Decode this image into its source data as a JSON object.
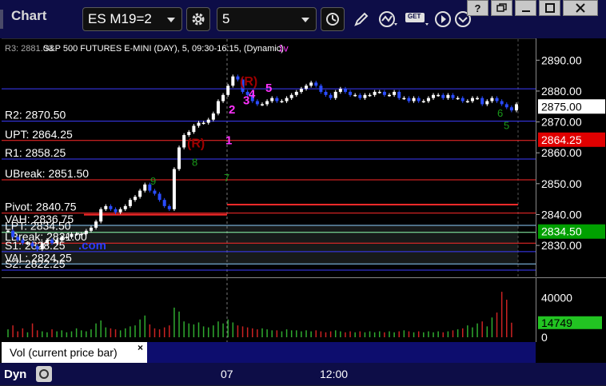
{
  "toolbar": {
    "title": "Chart",
    "symbol": "ES M19=2",
    "interval": "5",
    "get_badge": "GET"
  },
  "chart": {
    "header": "S&P 500 FUTURES E-MINI (DAY), 5, 09:30-16:15, (Dynamic)",
    "watermark_prefix": "RS",
    "watermark_suffix": ".com",
    "right_label_overlap": "R3: 2881.00",
    "level_labels": [
      {
        "key": "r2",
        "text": "R2: 2870.50",
        "color": "#ffffff"
      },
      {
        "key": "upt",
        "text": "UPT: 2864.25",
        "color": "#ffffff"
      },
      {
        "key": "r1",
        "text": "R1: 2858.25",
        "color": "#ffffff"
      },
      {
        "key": "ubreak",
        "text": "UBreak: 2851.50",
        "color": "#ffffff"
      },
      {
        "key": "pivot",
        "text": "Pivot: 2840.75",
        "color": "#ffffff"
      },
      {
        "key": "vah",
        "text": "VAH: 2836.75",
        "color": "#ffffff"
      },
      {
        "key": "lpt",
        "text": "LPT: 2834.50",
        "color": "#ffffff"
      },
      {
        "key": "lbreak",
        "text": "LBreak: 2831.00",
        "color": "#ffffff"
      },
      {
        "key": "s1",
        "text": "S1: 2828.25",
        "color": "#ffffff"
      },
      {
        "key": "val",
        "text": "VAL: 2824.25",
        "color": "#ffffff"
      },
      {
        "key": "s2",
        "text": "S2: 2822.25",
        "color": "#ffffff"
      }
    ],
    "annotations": {
      "r_marker": "(R)",
      "seq_magenta": [
        "1",
        "2",
        "3",
        "4",
        "5"
      ],
      "seq_top": "1v"
    },
    "price_ticks": [
      "2890.00",
      "2880.00",
      "2870.00",
      "2860.00",
      "2850.00",
      "2840.00",
      "2830.00"
    ],
    "price_boxes": {
      "last": {
        "text": "2875.00",
        "bg": "#ffffff",
        "fg": "#000000"
      },
      "upt": {
        "text": "2864.25",
        "bg": "#e00000",
        "fg": "#ffffff"
      },
      "lpt": {
        "text": "2834.50",
        "bg": "#00a000",
        "fg": "#ffffff"
      }
    }
  },
  "volume": {
    "ticks": [
      "40000",
      "0"
    ],
    "last": {
      "text": "14749",
      "bg": "#22c422",
      "fg": "#000000"
    },
    "indicator_label": "Vol (current price bar)",
    "close_glyph": "×"
  },
  "time_axis": {
    "ticks": [
      "07",
      "12:00"
    ],
    "dyn_label": "Dyn"
  },
  "chart_data": {
    "type": "candlestick",
    "ylim": [
      2822,
      2895
    ],
    "yticks": [
      2890,
      2880,
      2870,
      2860,
      2850,
      2840,
      2830
    ],
    "levels": [
      {
        "name": "R3",
        "value": 2881.0
      },
      {
        "name": "R2",
        "value": 2870.5
      },
      {
        "name": "UPT",
        "value": 2864.25
      },
      {
        "name": "R1",
        "value": 2858.25
      },
      {
        "name": "UBreak",
        "value": 2851.5
      },
      {
        "name": "Pivot",
        "value": 2840.75
      },
      {
        "name": "VAH",
        "value": 2836.75
      },
      {
        "name": "LPT",
        "value": 2834.5
      },
      {
        "name": "LBreak",
        "value": 2831.0
      },
      {
        "name": "S1",
        "value": 2828.25
      },
      {
        "name": "VAL",
        "value": 2824.25
      },
      {
        "name": "S2",
        "value": 2822.25
      }
    ],
    "last_price": 2875.0,
    "closes": [
      2835,
      2833,
      2832,
      2831,
      2831,
      2830,
      2829,
      2831,
      2832,
      2831,
      2832,
      2833,
      2833,
      2834,
      2834,
      2834,
      2835,
      2836,
      2838,
      2842,
      2843,
      2842,
      2841,
      2842,
      2843,
      2845,
      2846,
      2848,
      2850,
      2848,
      2847,
      2845,
      2843,
      2842,
      2855,
      2862,
      2866,
      2867,
      2869,
      2870,
      2870,
      2871,
      2873,
      2877,
      2879,
      2882,
      2885,
      2884,
      2880,
      2879,
      2877,
      2876,
      2876,
      2877,
      2878,
      2877,
      2877,
      2878,
      2879,
      2880,
      2881,
      2882,
      2883,
      2882,
      2880,
      2879,
      2878,
      2880,
      2881,
      2880,
      2879,
      2879,
      2878,
      2879,
      2879,
      2880,
      2880,
      2879,
      2879,
      2880,
      2878,
      2878,
      2877,
      2878,
      2877,
      2877,
      2878,
      2879,
      2879,
      2878,
      2879,
      2878,
      2878,
      2877,
      2877,
      2878,
      2878,
      2876,
      2877,
      2878,
      2877,
      2876,
      2875,
      2874,
      2876
    ],
    "volume_ylim": [
      0,
      55000
    ],
    "volume": [
      8000,
      12000,
      6000,
      9000,
      5000,
      14000,
      7000,
      6000,
      5000,
      8000,
      6000,
      7000,
      5000,
      6000,
      9000,
      7000,
      6000,
      8000,
      14000,
      17000,
      10000,
      9000,
      8000,
      7000,
      9000,
      11000,
      12000,
      18000,
      22000,
      13000,
      9000,
      8000,
      10000,
      12000,
      30000,
      26000,
      16000,
      14000,
      13000,
      15000,
      11000,
      10000,
      12000,
      16000,
      14000,
      18000,
      15000,
      12000,
      11000,
      10000,
      9000,
      8000,
      9000,
      8000,
      7000,
      7000,
      6000,
      8000,
      7000,
      7000,
      6000,
      7000,
      6000,
      7000,
      6000,
      5000,
      6000,
      7000,
      6000,
      5000,
      6000,
      5000,
      6000,
      5000,
      6000,
      5000,
      6000,
      5000,
      6000,
      5000,
      6000,
      7000,
      6000,
      5000,
      6000,
      5000,
      6000,
      5000,
      6000,
      5000,
      6000,
      7000,
      8000,
      9000,
      12000,
      10000,
      14000,
      16000,
      11000,
      20000,
      25000,
      46000,
      38000,
      14749
    ]
  }
}
